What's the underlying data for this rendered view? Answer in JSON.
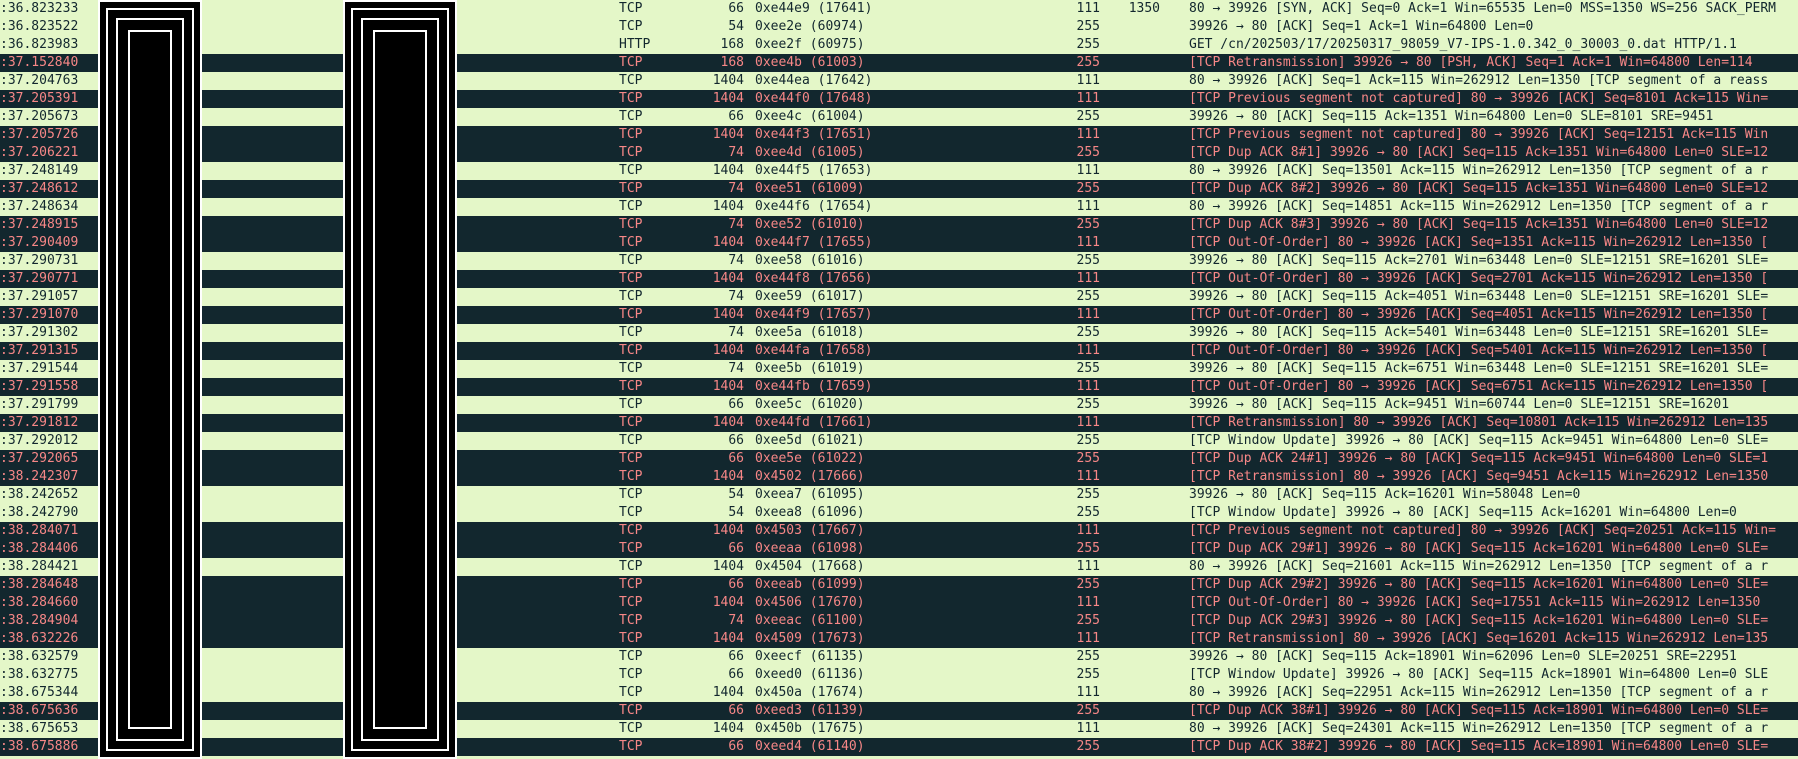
{
  "packets": [
    {
      "time": ":36.823233",
      "proto": "TCP",
      "len": "66",
      "ipid": "0xe44e9 (17641)",
      "ttl": "111",
      "win": "1350",
      "info": "80 → 39926 [SYN, ACK] Seq=0 Ack=1 Win=65535 Len=0 MSS=1350 WS=256 SACK_PERM",
      "bad": false
    },
    {
      "time": ":36.823522",
      "proto": "TCP",
      "len": "54",
      "ipid": "0xee2e (60974)",
      "ttl": "255",
      "win": "",
      "info": "39926 → 80 [ACK] Seq=1 Ack=1 Win=64800 Len=0",
      "bad": false
    },
    {
      "time": ":36.823983",
      "proto": "HTTP",
      "len": "168",
      "ipid": "0xee2f (60975)",
      "ttl": "255",
      "win": "",
      "info": "GET /cn/202503/17/20250317_98059_V7-IPS-1.0.342_0_30003_0.dat HTTP/1.1",
      "bad": false
    },
    {
      "time": ":37.152840",
      "proto": "TCP",
      "len": "168",
      "ipid": "0xee4b (61003)",
      "ttl": "255",
      "win": "",
      "info": "[TCP Retransmission] 39926 → 80 [PSH, ACK] Seq=1 Ack=1 Win=64800 Len=114",
      "bad": true
    },
    {
      "time": ":37.204763",
      "proto": "TCP",
      "len": "1404",
      "ipid": "0xe44ea (17642)",
      "ttl": "111",
      "win": "",
      "info": "80 → 39926 [ACK] Seq=1 Ack=115 Win=262912 Len=1350 [TCP segment of a reass",
      "bad": false
    },
    {
      "time": ":37.205391",
      "proto": "TCP",
      "len": "1404",
      "ipid": "0xe44f0 (17648)",
      "ttl": "111",
      "win": "",
      "info": "[TCP Previous segment not captured] 80 → 39926 [ACK] Seq=8101 Ack=115 Win=",
      "bad": true
    },
    {
      "time": ":37.205673",
      "proto": "TCP",
      "len": "66",
      "ipid": "0xee4c (61004)",
      "ttl": "255",
      "win": "",
      "info": "39926 → 80 [ACK] Seq=115 Ack=1351 Win=64800 Len=0 SLE=8101 SRE=9451",
      "bad": false
    },
    {
      "time": ":37.205726",
      "proto": "TCP",
      "len": "1404",
      "ipid": "0xe44f3 (17651)",
      "ttl": "111",
      "win": "",
      "info": "[TCP Previous segment not captured] 80 → 39926 [ACK] Seq=12151 Ack=115 Win",
      "bad": true
    },
    {
      "time": ":37.206221",
      "proto": "TCP",
      "len": "74",
      "ipid": "0xee4d (61005)",
      "ttl": "255",
      "win": "",
      "info": "[TCP Dup ACK 8#1] 39926 → 80 [ACK] Seq=115 Ack=1351 Win=64800 Len=0 SLE=12",
      "bad": true
    },
    {
      "time": ":37.248149",
      "proto": "TCP",
      "len": "1404",
      "ipid": "0xe44f5 (17653)",
      "ttl": "111",
      "win": "",
      "info": "80 → 39926 [ACK] Seq=13501 Ack=115 Win=262912 Len=1350 [TCP segment of a r",
      "bad": false
    },
    {
      "time": ":37.248612",
      "proto": "TCP",
      "len": "74",
      "ipid": "0xee51 (61009)",
      "ttl": "255",
      "win": "",
      "info": "[TCP Dup ACK 8#2] 39926 → 80 [ACK] Seq=115 Ack=1351 Win=64800 Len=0 SLE=12",
      "bad": true
    },
    {
      "time": ":37.248634",
      "proto": "TCP",
      "len": "1404",
      "ipid": "0xe44f6 (17654)",
      "ttl": "111",
      "win": "",
      "info": "80 → 39926 [ACK] Seq=14851 Ack=115 Win=262912 Len=1350 [TCP segment of a r",
      "bad": false
    },
    {
      "time": ":37.248915",
      "proto": "TCP",
      "len": "74",
      "ipid": "0xee52 (61010)",
      "ttl": "255",
      "win": "",
      "info": "[TCP Dup ACK 8#3] 39926 → 80 [ACK] Seq=115 Ack=1351 Win=64800 Len=0 SLE=12",
      "bad": true
    },
    {
      "time": ":37.290409",
      "proto": "TCP",
      "len": "1404",
      "ipid": "0xe44f7 (17655)",
      "ttl": "111",
      "win": "",
      "info": "[TCP Out-Of-Order] 80 → 39926 [ACK] Seq=1351 Ack=115 Win=262912 Len=1350 [",
      "bad": true
    },
    {
      "time": ":37.290731",
      "proto": "TCP",
      "len": "74",
      "ipid": "0xee58 (61016)",
      "ttl": "255",
      "win": "",
      "info": "39926 → 80 [ACK] Seq=115 Ack=2701 Win=63448 Len=0 SLE=12151 SRE=16201 SLE=",
      "bad": false
    },
    {
      "time": ":37.290771",
      "proto": "TCP",
      "len": "1404",
      "ipid": "0xe44f8 (17656)",
      "ttl": "111",
      "win": "",
      "info": "[TCP Out-Of-Order] 80 → 39926 [ACK] Seq=2701 Ack=115 Win=262912 Len=1350 [",
      "bad": true
    },
    {
      "time": ":37.291057",
      "proto": "TCP",
      "len": "74",
      "ipid": "0xee59 (61017)",
      "ttl": "255",
      "win": "",
      "info": "39926 → 80 [ACK] Seq=115 Ack=4051 Win=63448 Len=0 SLE=12151 SRE=16201 SLE=",
      "bad": false
    },
    {
      "time": ":37.291070",
      "proto": "TCP",
      "len": "1404",
      "ipid": "0xe44f9 (17657)",
      "ttl": "111",
      "win": "",
      "info": "[TCP Out-Of-Order] 80 → 39926 [ACK] Seq=4051 Ack=115 Win=262912 Len=1350 [",
      "bad": true
    },
    {
      "time": ":37.291302",
      "proto": "TCP",
      "len": "74",
      "ipid": "0xee5a (61018)",
      "ttl": "255",
      "win": "",
      "info": "39926 → 80 [ACK] Seq=115 Ack=5401 Win=63448 Len=0 SLE=12151 SRE=16201 SLE=",
      "bad": false
    },
    {
      "time": ":37.291315",
      "proto": "TCP",
      "len": "1404",
      "ipid": "0xe44fa (17658)",
      "ttl": "111",
      "win": "",
      "info": "[TCP Out-Of-Order] 80 → 39926 [ACK] Seq=5401 Ack=115 Win=262912 Len=1350 [",
      "bad": true
    },
    {
      "time": ":37.291544",
      "proto": "TCP",
      "len": "74",
      "ipid": "0xee5b (61019)",
      "ttl": "255",
      "win": "",
      "info": "39926 → 80 [ACK] Seq=115 Ack=6751 Win=63448 Len=0 SLE=12151 SRE=16201 SLE=",
      "bad": false
    },
    {
      "time": ":37.291558",
      "proto": "TCP",
      "len": "1404",
      "ipid": "0xe44fb (17659)",
      "ttl": "111",
      "win": "",
      "info": "[TCP Out-Of-Order] 80 → 39926 [ACK] Seq=6751 Ack=115 Win=262912 Len=1350 [",
      "bad": true
    },
    {
      "time": ":37.291799",
      "proto": "TCP",
      "len": "66",
      "ipid": "0xee5c (61020)",
      "ttl": "255",
      "win": "",
      "info": "39926 → 80 [ACK] Seq=115 Ack=9451 Win=60744 Len=0 SLE=12151 SRE=16201",
      "bad": false
    },
    {
      "time": ":37.291812",
      "proto": "TCP",
      "len": "1404",
      "ipid": "0xe44fd (17661)",
      "ttl": "111",
      "win": "",
      "info": "[TCP Retransmission] 80 → 39926 [ACK] Seq=10801 Ack=115 Win=262912 Len=135",
      "bad": true
    },
    {
      "time": ":37.292012",
      "proto": "TCP",
      "len": "66",
      "ipid": "0xee5d (61021)",
      "ttl": "255",
      "win": "",
      "info": "[TCP Window Update] 39926 → 80 [ACK] Seq=115 Ack=9451 Win=64800 Len=0 SLE=",
      "bad": false
    },
    {
      "time": ":37.292065",
      "proto": "TCP",
      "len": "66",
      "ipid": "0xee5e (61022)",
      "ttl": "255",
      "win": "",
      "info": "[TCP Dup ACK 24#1] 39926 → 80 [ACK] Seq=115 Ack=9451 Win=64800 Len=0 SLE=1",
      "bad": true
    },
    {
      "time": ":38.242307",
      "proto": "TCP",
      "len": "1404",
      "ipid": "0x4502 (17666)",
      "ttl": "111",
      "win": "",
      "info": "[TCP Retransmission] 80 → 39926 [ACK] Seq=9451 Ack=115 Win=262912 Len=1350",
      "bad": true
    },
    {
      "time": ":38.242652",
      "proto": "TCP",
      "len": "54",
      "ipid": "0xeea7 (61095)",
      "ttl": "255",
      "win": "",
      "info": "39926 → 80 [ACK] Seq=115 Ack=16201 Win=58048 Len=0",
      "bad": false
    },
    {
      "time": ":38.242790",
      "proto": "TCP",
      "len": "54",
      "ipid": "0xeea8 (61096)",
      "ttl": "255",
      "win": "",
      "info": "[TCP Window Update] 39926 → 80 [ACK] Seq=115 Ack=16201 Win=64800 Len=0",
      "bad": false
    },
    {
      "time": ":38.284071",
      "proto": "TCP",
      "len": "1404",
      "ipid": "0x4503 (17667)",
      "ttl": "111",
      "win": "",
      "info": "[TCP Previous segment not captured] 80 → 39926 [ACK] Seq=20251 Ack=115 Win=",
      "bad": true
    },
    {
      "time": ":38.284406",
      "proto": "TCP",
      "len": "66",
      "ipid": "0xeeaa (61098)",
      "ttl": "255",
      "win": "",
      "info": "[TCP Dup ACK 29#1] 39926 → 80 [ACK] Seq=115 Ack=16201 Win=64800 Len=0 SLE=",
      "bad": true
    },
    {
      "time": ":38.284421",
      "proto": "TCP",
      "len": "1404",
      "ipid": "0x4504 (17668)",
      "ttl": "111",
      "win": "",
      "info": "80 → 39926 [ACK] Seq=21601 Ack=115 Win=262912 Len=1350 [TCP segment of a r",
      "bad": false
    },
    {
      "time": ":38.284648",
      "proto": "TCP",
      "len": "66",
      "ipid": "0xeeab (61099)",
      "ttl": "255",
      "win": "",
      "info": "[TCP Dup ACK 29#2] 39926 → 80 [ACK] Seq=115 Ack=16201 Win=64800 Len=0 SLE=",
      "bad": true
    },
    {
      "time": ":38.284660",
      "proto": "TCP",
      "len": "1404",
      "ipid": "0x4506 (17670)",
      "ttl": "111",
      "win": "",
      "info": "[TCP Out-Of-Order] 80 → 39926 [ACK] Seq=17551 Ack=115 Win=262912 Len=1350",
      "bad": true
    },
    {
      "time": ":38.284904",
      "proto": "TCP",
      "len": "74",
      "ipid": "0xeeac (61100)",
      "ttl": "255",
      "win": "",
      "info": "[TCP Dup ACK 29#3] 39926 → 80 [ACK] Seq=115 Ack=16201 Win=64800 Len=0 SLE=",
      "bad": true
    },
    {
      "time": ":38.632226",
      "proto": "TCP",
      "len": "1404",
      "ipid": "0x4509 (17673)",
      "ttl": "111",
      "win": "",
      "info": "[TCP Retransmission] 80 → 39926 [ACK] Seq=16201 Ack=115 Win=262912 Len=135",
      "bad": true
    },
    {
      "time": ":38.632579",
      "proto": "TCP",
      "len": "66",
      "ipid": "0xeecf (61135)",
      "ttl": "255",
      "win": "",
      "info": "39926 → 80 [ACK] Seq=115 Ack=18901 Win=62096 Len=0 SLE=20251 SRE=22951",
      "bad": false
    },
    {
      "time": ":38.632775",
      "proto": "TCP",
      "len": "66",
      "ipid": "0xeed0 (61136)",
      "ttl": "255",
      "win": "",
      "info": "[TCP Window Update] 39926 → 80 [ACK] Seq=115 Ack=18901 Win=64800 Len=0 SLE",
      "bad": false
    },
    {
      "time": ":38.675344",
      "proto": "TCP",
      "len": "1404",
      "ipid": "0x450a (17674)",
      "ttl": "111",
      "win": "",
      "info": "80 → 39926 [ACK] Seq=22951 Ack=115 Win=262912 Len=1350 [TCP segment of a r",
      "bad": false
    },
    {
      "time": ":38.675636",
      "proto": "TCP",
      "len": "66",
      "ipid": "0xeed3 (61139)",
      "ttl": "255",
      "win": "",
      "info": "[TCP Dup ACK 38#1] 39926 → 80 [ACK] Seq=115 Ack=18901 Win=64800 Len=0 SLE=",
      "bad": true
    },
    {
      "time": ":38.675653",
      "proto": "TCP",
      "len": "1404",
      "ipid": "0x450b (17675)",
      "ttl": "111",
      "win": "",
      "info": "80 → 39926 [ACK] Seq=24301 Ack=115 Win=262912 Len=1350 [TCP segment of a r",
      "bad": false
    },
    {
      "time": ":38.675886",
      "proto": "TCP",
      "len": "66",
      "ipid": "0xeed4 (61140)",
      "ttl": "255",
      "win": "",
      "info": "[TCP Dup ACK 38#2] 39926 → 80 [ACK] Seq=115 Ack=18901 Win=64800 Len=0 SLE=",
      "bad": true
    }
  ],
  "colors": {
    "normal_bg": "#e4f7c8",
    "normal_fg": "#12272e",
    "bad_bg": "#12272e",
    "bad_fg": "#f78787",
    "redaction": "#000000"
  }
}
